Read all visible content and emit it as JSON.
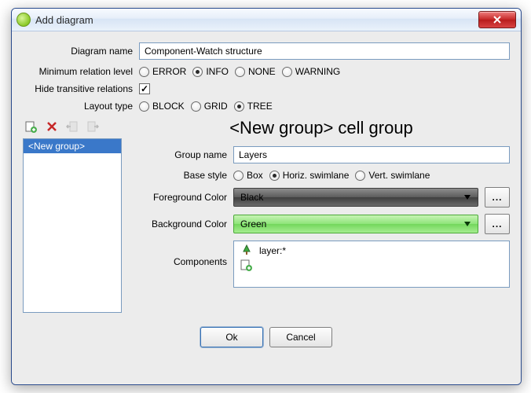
{
  "window": {
    "title": "Add diagram"
  },
  "labels": {
    "diagram_name": "Diagram name",
    "min_relation": "Minimum relation level",
    "hide_transitive": "Hide transitive relations",
    "layout_type": "Layout type",
    "group_name": "Group name",
    "base_style": "Base style",
    "foreground": "Foreground Color",
    "background": "Background Color",
    "components": "Components"
  },
  "fields": {
    "diagram_name_value": "Component-Watch structure",
    "group_name_value": "Layers"
  },
  "radios": {
    "relation": {
      "options": [
        "ERROR",
        "INFO",
        "NONE",
        "WARNING"
      ],
      "selected": "INFO"
    },
    "layout": {
      "options": [
        "BLOCK",
        "GRID",
        "TREE"
      ],
      "selected": "TREE"
    },
    "base_style": {
      "options": [
        "Box",
        "Horiz. swimlane",
        "Vert. swimlane"
      ],
      "selected": "Horiz. swimlane"
    }
  },
  "checkboxes": {
    "hide_transitive": true
  },
  "group_list": {
    "items": [
      "<New group>"
    ],
    "selected": "<New group>"
  },
  "group_panel": {
    "title": "<New group> cell group"
  },
  "colors": {
    "foreground_label": "Black",
    "background_label": "Green",
    "edit_btn": "..."
  },
  "components": {
    "pattern": "layer:*"
  },
  "buttons": {
    "ok": "Ok",
    "cancel": "Cancel"
  }
}
